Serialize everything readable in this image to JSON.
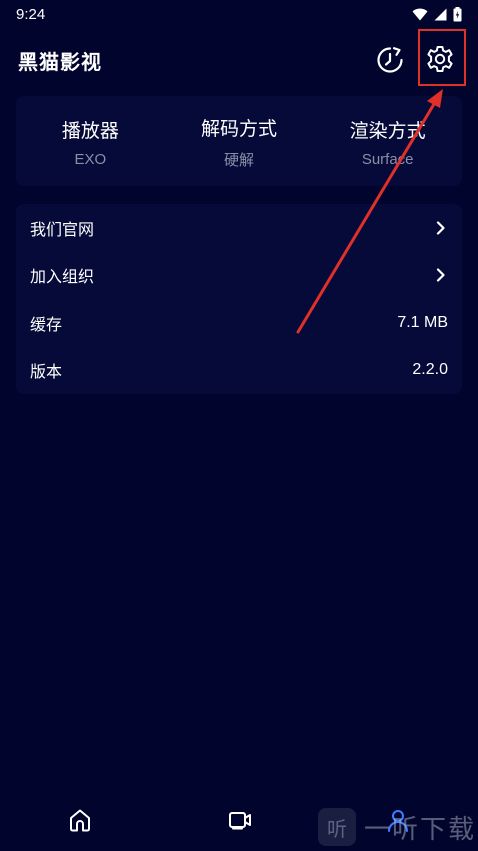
{
  "status_bar": {
    "time": "9:24"
  },
  "header": {
    "title": "黑猫影视",
    "history_icon": "history-icon",
    "settings_icon": "gear-icon"
  },
  "player_settings": [
    {
      "label": "播放器",
      "value": "EXO"
    },
    {
      "label": "解码方式",
      "value": "硬解"
    },
    {
      "label": "渲染方式",
      "value": "Surface"
    }
  ],
  "settings_list": [
    {
      "label": "我们官网",
      "value": "",
      "icon": "chevron-right-icon"
    },
    {
      "label": "加入组织",
      "value": "",
      "icon": "chevron-right-icon"
    },
    {
      "label": "缓存",
      "value": "7.1 MB"
    },
    {
      "label": "版本",
      "value": "2.2.0"
    }
  ],
  "bottom_nav": {
    "items": [
      "home-icon",
      "video-icon",
      "profile-icon"
    ]
  },
  "watermark": {
    "logo_text": "听",
    "text": "一听下载"
  },
  "colors": {
    "background": "#01052e",
    "card": "#050a38",
    "secondary_text": "#8a8fa8",
    "annotation": "#e0302a"
  }
}
